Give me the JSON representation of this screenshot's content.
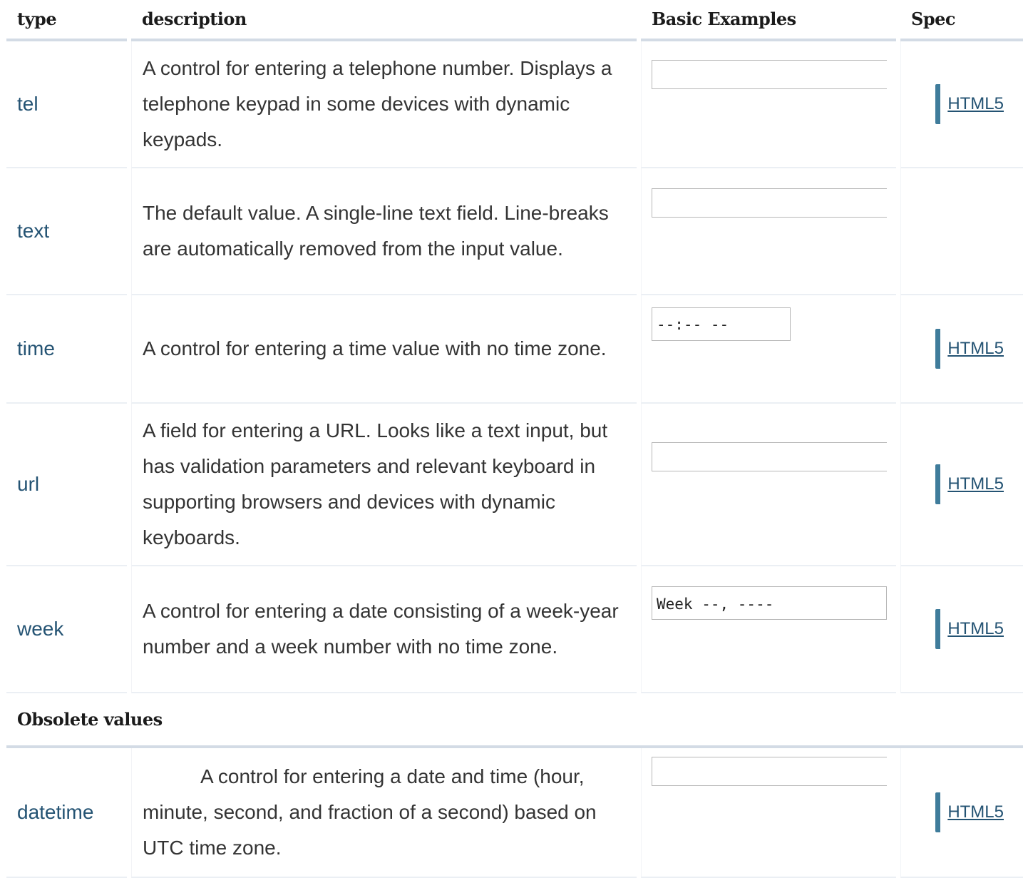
{
  "header": {
    "type": "type",
    "description": "description",
    "examples": "Basic Examples",
    "spec": "Spec"
  },
  "rows": [
    {
      "type": "tel",
      "description": "A control for entering a telephone number. Displays a telephone keypad in some devices with dynamic keypads.",
      "example": "",
      "spec": "HTML5"
    },
    {
      "type": "text",
      "description": "The default value. A single-line text field. Line-breaks are automatically removed from the input value.",
      "example": "",
      "spec": ""
    },
    {
      "type": "time",
      "description": "A control for entering a time value with no time zone.",
      "example": "--:-- --",
      "spec": "HTML5"
    },
    {
      "type": "url",
      "description": "A field for entering a URL. Looks like a text input, but has validation parameters and relevant keyboard in supporting browsers and devices with dynamic keyboards.",
      "example": "",
      "spec": "HTML5"
    },
    {
      "type": "week",
      "description": "A control for entering a date consisting of a week-year number and a week number with no time zone.",
      "example": "Week --, ----",
      "spec": "HTML5"
    }
  ],
  "obsolete": {
    "title": "Obsolete values",
    "rows": [
      {
        "type": "datetime",
        "description": "A control for entering a date and time (hour, minute, second, and fraction of a second) based on UTC time zone.",
        "example": "",
        "spec": "HTML5"
      }
    ]
  }
}
